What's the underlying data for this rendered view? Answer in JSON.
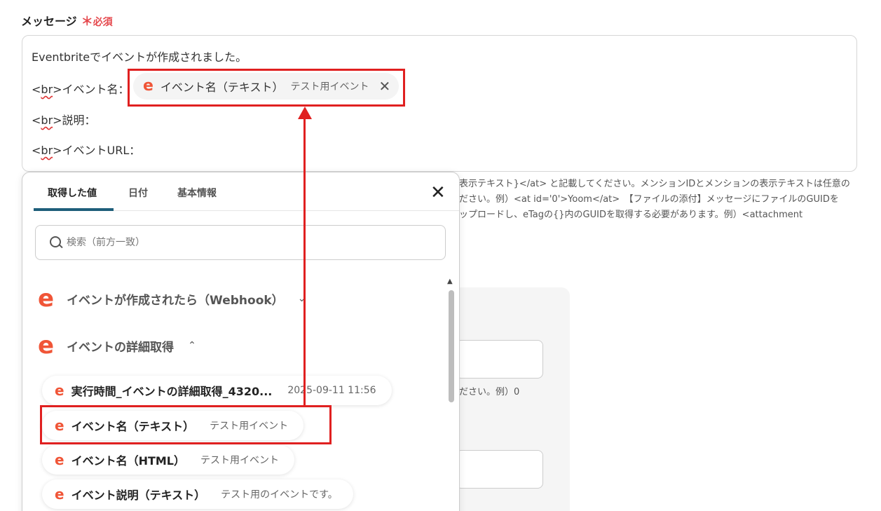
{
  "field": {
    "label": "メッセージ",
    "required_star": "＊",
    "required_text": "必須"
  },
  "editor": {
    "line1": "Eventbriteでイベントが作成されました。",
    "br_tag_open": "<",
    "br_tag_word": "br",
    "br_tag_close": ">",
    "line2_text": "イベント名：",
    "line3_text": "説明：",
    "line4_text": "イベントURL：",
    "token": {
      "label": "イベント名（テキスト）",
      "value": "テスト用イベント",
      "remove": "✕"
    }
  },
  "help": {
    "line1": "表示テキスト}</at> と記載してください。メンションIDとメンションの表示テキストは任意の",
    "line2": "ださい。例）<at id='0'>Yoom</at>　【ファイルの添付】メッセージにファイルのGUIDを",
    "line3": "ップロードし、eTagの{}内のGUIDを取得する必要があります。例）<attachment",
    "note2": "ださい。例）0"
  },
  "popup": {
    "tabs": [
      "取得した値",
      "日付",
      "基本情報"
    ],
    "active_tab": 0,
    "close": "✕",
    "search_placeholder": "検索（前方一致）",
    "groups": [
      {
        "title": "イベントが作成されたら（Webhook）",
        "chevron": "⌄"
      },
      {
        "title": "イベントの詳細取得",
        "chevron": "⌃"
      }
    ],
    "items": [
      {
        "label": "実行時間_イベントの詳細取得_4320...",
        "value": "2025-09-11 11:56"
      },
      {
        "label": "イベント名（テキスト）",
        "value": "テスト用イベント"
      },
      {
        "label": "イベント名（HTML）",
        "value": "テスト用イベント"
      },
      {
        "label": "イベント説明（テキスト）",
        "value": "テスト用のイベントです。"
      }
    ],
    "scroll_up": "▲"
  },
  "icons": {
    "eventbrite_logo": "e",
    "search_icon": "search-icon",
    "brand_color": "#f05537",
    "highlight_color": "#e02020"
  }
}
